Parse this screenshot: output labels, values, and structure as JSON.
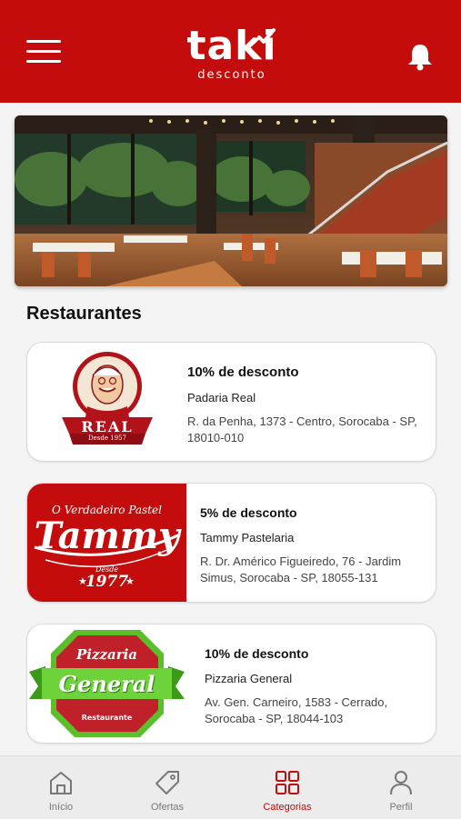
{
  "header": {
    "brand": "taki",
    "brand_sub": "desconto",
    "accent": "#c40c0c"
  },
  "section": {
    "title": "Restaurantes"
  },
  "restaurants": [
    {
      "discount": "10% de desconto",
      "name": "Padaria Real",
      "address": "R. da Penha, 1373 - Centro, Sorocaba - SP, 18010-010",
      "logo": {
        "text": "REAL",
        "since": "Desde 1957"
      }
    },
    {
      "discount": "5% de desconto",
      "name": "Tammy Pastelaria",
      "address": "R. Dr. Américo Figueiredo, 76 - Jardim Simus, Sorocaba - SP, 18055-131",
      "logo": {
        "tagline": "O Verdadeiro Pastel",
        "text": "Tammy",
        "since": "Desde",
        "year": "1977"
      }
    },
    {
      "discount": "10% de desconto",
      "name": "Pizzaria General",
      "address": "Av. Gen. Carneiro, 1583 - Cerrado, Sorocaba - SP, 18044-103",
      "logo": {
        "top": "Pizzaria",
        "text": "General",
        "bottom": "Restaurante"
      }
    }
  ],
  "nav": [
    {
      "label": "Início",
      "icon": "home-icon",
      "active": false
    },
    {
      "label": "Ofertas",
      "icon": "tag-icon",
      "active": false
    },
    {
      "label": "Categorias",
      "icon": "grid-icon",
      "active": true
    },
    {
      "label": "Perfil",
      "icon": "user-icon",
      "active": false
    }
  ]
}
